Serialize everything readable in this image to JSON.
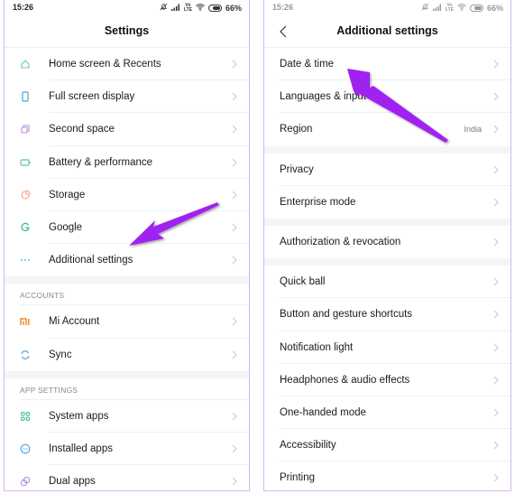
{
  "status_bar": {
    "time": "15:26",
    "battery": "66%",
    "network": "VoLTE"
  },
  "left_screen": {
    "title": "Settings",
    "items_top": [
      {
        "label": "Home screen & Recents",
        "icon": "home-icon"
      },
      {
        "label": "Full screen display",
        "icon": "phone-screen-icon"
      },
      {
        "label": "Second space",
        "icon": "second-space-icon"
      },
      {
        "label": "Battery & performance",
        "icon": "battery-icon"
      },
      {
        "label": "Storage",
        "icon": "storage-pie-icon"
      },
      {
        "label": "Google",
        "icon": "google-icon"
      },
      {
        "label": "Additional settings",
        "icon": "more-dots-icon"
      }
    ],
    "accounts_header": "ACCOUNTS",
    "accounts_items": [
      {
        "label": "Mi Account",
        "icon": "mi-logo-icon"
      },
      {
        "label": "Sync",
        "icon": "sync-icon"
      }
    ],
    "app_settings_header": "APP SETTINGS",
    "app_settings_items": [
      {
        "label": "System apps",
        "icon": "grid-apps-icon"
      },
      {
        "label": "Installed apps",
        "icon": "installed-apps-icon"
      },
      {
        "label": "Dual apps",
        "icon": "dual-apps-icon"
      }
    ]
  },
  "right_screen": {
    "title": "Additional settings",
    "group1": [
      {
        "label": "Date & time"
      },
      {
        "label": "Languages & input"
      },
      {
        "label": "Region",
        "value": "India"
      }
    ],
    "group2": [
      {
        "label": "Privacy"
      },
      {
        "label": "Enterprise mode"
      }
    ],
    "group3": [
      {
        "label": "Authorization & revocation"
      }
    ],
    "group4": [
      {
        "label": "Quick ball"
      },
      {
        "label": "Button and gesture shortcuts"
      },
      {
        "label": "Notification light"
      },
      {
        "label": "Headphones & audio effects"
      },
      {
        "label": "One-handed mode"
      },
      {
        "label": "Accessibility"
      },
      {
        "label": "Printing"
      }
    ]
  },
  "annotation": {
    "arrow_color": "#a020f0"
  }
}
